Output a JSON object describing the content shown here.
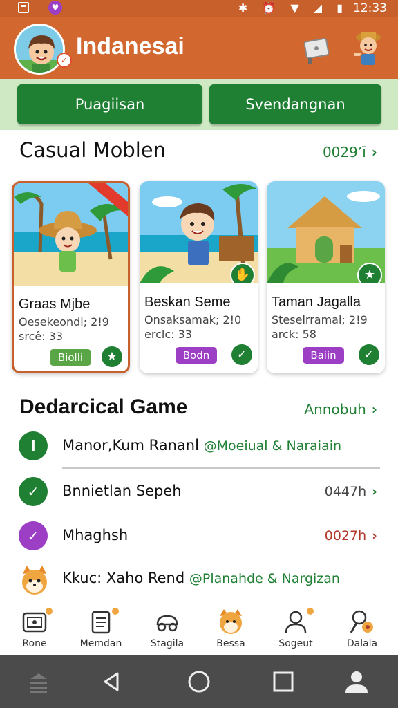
{
  "status_bar": {
    "time": "12:33"
  },
  "header": {
    "title": "Indanesai",
    "avatar_badge": "✓"
  },
  "segment": {
    "left_label": "Puagiisan",
    "right_label": "Svendangnan"
  },
  "casual": {
    "title": "Casual Moblen",
    "link": "0029’ī",
    "cards": [
      {
        "name": "Graas Mjbe",
        "line1": "Oesekeondl; 2!9",
        "line2": "srcê: 33",
        "tag": "Biolli",
        "tag_color": "#5aa546"
      },
      {
        "name": "Beskan Seme",
        "line1": "Onsaksamak; 2!0",
        "line2": "erclc: 33",
        "tag": "Bodn",
        "tag_color": "#9c3fc5"
      },
      {
        "name": "Taman Jagalla",
        "line1": "Steselrramal; 2!9",
        "line2": "arck: 58",
        "tag": "Baiin",
        "tag_color": "#9c3fc5"
      }
    ]
  },
  "dedarcical": {
    "title": "Dedarcical Game",
    "link": "Annobuh",
    "rows": [
      {
        "label": "Manor,Kum Rananl",
        "highlight": "@Moeiual & Naraiain",
        "value": "",
        "icon": "I",
        "icon_color": "#1f7f33"
      },
      {
        "label": "Bnnietlan Sepeh",
        "highlight": "",
        "value": "0447h",
        "icon": "✓",
        "icon_color": "#1f7f33"
      },
      {
        "label": "Mhaghsh",
        "highlight": "",
        "value": "0027h",
        "icon": "✓",
        "icon_color": "#9c3fc5"
      },
      {
        "label": "Kkuc: Xaho Rend",
        "highlight": "@Planahde & Nargizan",
        "value": "",
        "icon": "",
        "icon_color": "#f0a640"
      }
    ]
  },
  "bottom_nav": [
    {
      "label": "Rone"
    },
    {
      "label": "Memdan"
    },
    {
      "label": "Stagila"
    },
    {
      "label": "Bessa"
    },
    {
      "label": "Sogeut"
    },
    {
      "label": "Dalala"
    }
  ],
  "colors": {
    "primary": "#1f7f33",
    "header": "#d2682f",
    "accent_purple": "#9c3fc5",
    "segment_bg": "#cfe9c4"
  }
}
